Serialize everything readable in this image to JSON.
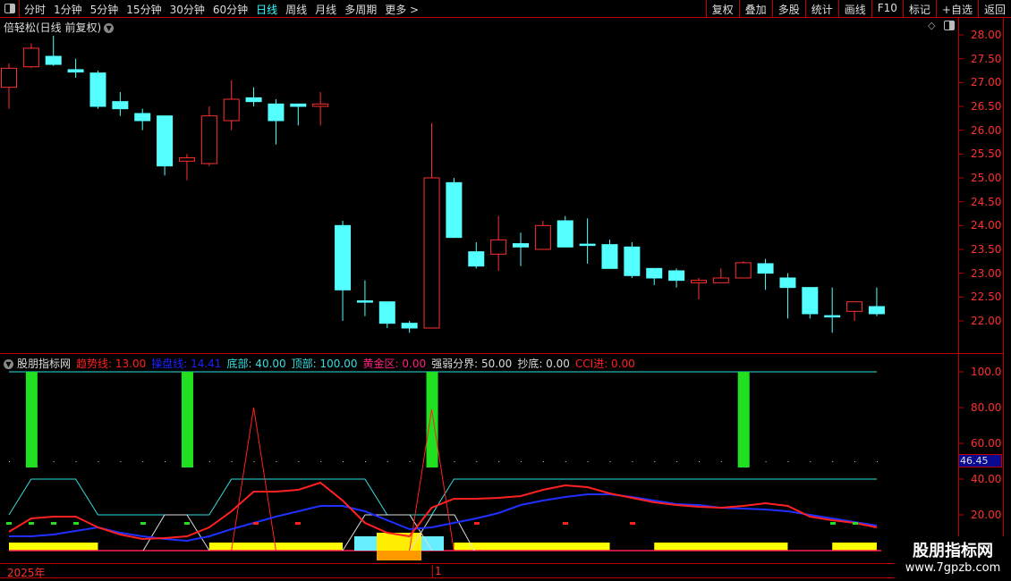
{
  "toolbar": {
    "periods": [
      "分时",
      "1分钟",
      "5分钟",
      "15分钟",
      "30分钟",
      "60分钟",
      "日线",
      "周线",
      "月线",
      "多周期",
      "更多 >"
    ],
    "active_period": "日线",
    "right_buttons": [
      "复权",
      "叠加",
      "多股",
      "统计",
      "画线",
      "F10",
      "标记",
      "+自选",
      "返回"
    ]
  },
  "main": {
    "title": "倍轻松(日线 前复权)",
    "price_ticks": [
      "28.00",
      "27.50",
      "27.00",
      "26.50",
      "26.00",
      "25.50",
      "25.00",
      "24.50",
      "24.00",
      "23.50",
      "23.00",
      "22.50",
      "22.00"
    ]
  },
  "indicator": {
    "name": "股朋指标网",
    "values": [
      {
        "label": "趋势线: 13.00",
        "color": "#ff2020"
      },
      {
        "label": "操盘线: 14.41",
        "color": "#2020ff"
      },
      {
        "label": "底部: 40.00",
        "color": "#30e0e0"
      },
      {
        "label": "顶部: 100.00",
        "color": "#30e0e0"
      },
      {
        "label": "黄金区: 0.00",
        "color": "#ff2080"
      },
      {
        "label": "强弱分界: 50.00",
        "color": "#dddddd"
      },
      {
        "label": "抄底: 0.00",
        "color": "#dddddd"
      },
      {
        "label": "CCI进: 0.00",
        "color": "#ff2020"
      }
    ],
    "ticks": [
      "100.0",
      "80.00",
      "60.00",
      "40.00",
      "20.00"
    ],
    "current_value": "46.45"
  },
  "datebar": {
    "year": "2025年",
    "month": "1"
  },
  "watermark": {
    "line1": "股朋指标网",
    "line2": "www.7gpzb.com"
  },
  "chart_data": {
    "type": "candlestick",
    "ylim": [
      21.6,
      28.2
    ],
    "candles": [
      [
        26.9,
        27.3,
        27.4,
        26.45
      ],
      [
        27.33,
        27.72,
        27.82,
        27.3
      ],
      [
        27.55,
        27.38,
        27.98,
        27.35
      ],
      [
        27.27,
        27.22,
        27.5,
        27.1
      ],
      [
        27.2,
        26.5,
        27.25,
        26.45
      ],
      [
        26.6,
        26.45,
        26.8,
        26.3
      ],
      [
        26.35,
        26.2,
        26.45,
        26.0
      ],
      [
        26.3,
        25.25,
        26.3,
        25.05
      ],
      [
        25.35,
        25.42,
        25.5,
        24.95
      ],
      [
        25.3,
        26.3,
        26.5,
        25.25
      ],
      [
        26.2,
        26.65,
        27.05,
        26.0
      ],
      [
        26.68,
        26.6,
        26.9,
        26.5
      ],
      [
        26.55,
        26.2,
        26.65,
        25.7
      ],
      [
        26.55,
        26.5,
        26.55,
        26.1
      ],
      [
        26.5,
        26.55,
        26.8,
        26.1
      ],
      [
        24.0,
        22.65,
        24.1,
        22.0
      ],
      [
        22.42,
        22.4,
        22.85,
        22.1
      ],
      [
        22.4,
        21.95,
        22.4,
        21.85
      ],
      [
        21.95,
        21.85,
        22.0,
        21.75
      ],
      [
        21.85,
        25.0,
        26.15,
        21.85
      ],
      [
        24.9,
        23.75,
        25.0,
        23.75
      ],
      [
        23.45,
        23.15,
        23.65,
        23.1
      ],
      [
        23.4,
        23.7,
        24.2,
        23.05
      ],
      [
        23.62,
        23.55,
        23.85,
        23.15
      ],
      [
        23.5,
        24.0,
        24.1,
        23.5
      ],
      [
        24.1,
        23.55,
        24.2,
        23.55
      ],
      [
        23.61,
        23.6,
        24.15,
        23.2
      ],
      [
        23.6,
        23.1,
        23.7,
        23.1
      ],
      [
        23.55,
        22.95,
        23.65,
        22.9
      ],
      [
        23.1,
        22.9,
        23.1,
        22.75
      ],
      [
        23.05,
        22.85,
        23.1,
        22.7
      ],
      [
        22.8,
        22.85,
        22.9,
        22.45
      ],
      [
        22.8,
        22.9,
        23.1,
        22.8
      ],
      [
        22.9,
        23.22,
        23.25,
        22.9
      ],
      [
        23.2,
        23.0,
        23.3,
        22.65
      ],
      [
        22.9,
        22.7,
        23.0,
        22.05
      ],
      [
        22.7,
        22.15,
        22.7,
        22.05
      ],
      [
        22.11,
        22.1,
        22.7,
        21.75
      ],
      [
        22.2,
        22.4,
        22.4,
        22.0
      ],
      [
        22.3,
        22.15,
        22.7,
        22.1
      ]
    ],
    "indicator_ylim": [
      0,
      105
    ],
    "trend_line": [
      10.5,
      18,
      19,
      19,
      13,
      9,
      6.5,
      7,
      8,
      13,
      22,
      33,
      33,
      34,
      38,
      28,
      15.5,
      10,
      8,
      24,
      29,
      29,
      29.5,
      30.5,
      34,
      36.5,
      35.5,
      32,
      29.5,
      27,
      25.5,
      24.5,
      24,
      25,
      26.5,
      25,
      19,
      17,
      15.5,
      13
    ],
    "operate_line": [
      8,
      8,
      9,
      11,
      13,
      10,
      8,
      6.5,
      5.5,
      8,
      12,
      15.5,
      19,
      22,
      25,
      25,
      22,
      17,
      12,
      13,
      15.5,
      18,
      21,
      25.5,
      28,
      30,
      31.5,
      31.5,
      30,
      28,
      26,
      25.5,
      24,
      23.5,
      23,
      22,
      20,
      18,
      16,
      14
    ],
    "band_line": [
      20,
      40,
      40,
      40,
      20,
      20,
      20,
      20,
      20,
      20,
      40,
      40,
      40,
      40,
      40,
      40,
      40,
      20,
      20,
      20,
      40,
      40,
      40,
      40,
      40,
      40,
      40,
      40,
      40,
      40,
      40,
      40,
      40,
      40,
      40,
      40,
      40,
      40,
      40,
      40
    ],
    "top_line": 100,
    "mid_line": 50,
    "signal_bars": [
      1,
      8,
      19,
      33
    ],
    "spikes": [
      {
        "index": 11,
        "value": 80
      },
      {
        "index": 19,
        "value": 79
      }
    ],
    "yellow_zones": [
      [
        0,
        4
      ],
      [
        9,
        15
      ],
      [
        20,
        27
      ],
      [
        29,
        35
      ],
      [
        37,
        39
      ]
    ]
  }
}
